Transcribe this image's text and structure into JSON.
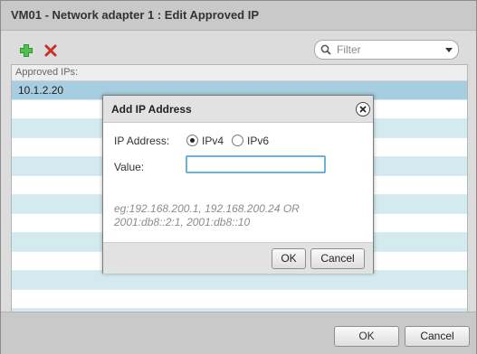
{
  "window": {
    "title": "VM01 - Network adapter 1 : Edit Approved IP",
    "ok_label": "OK",
    "cancel_label": "Cancel"
  },
  "toolbar": {
    "add_icon": "plus-icon",
    "delete_icon": "x-icon",
    "filter_placeholder": "Filter"
  },
  "grid": {
    "header": "Approved IPs:",
    "rows": [
      "10.1.2.20",
      "",
      "",
      "",
      "",
      "",
      "",
      "",
      "",
      "",
      "",
      "",
      ""
    ]
  },
  "dialog": {
    "title": "Add IP Address",
    "ip_address_label": "IP Address:",
    "ipv4_label": "IPv4",
    "ipv6_label": "IPv6",
    "selected": "IPv4",
    "value_label": "Value:",
    "value": "",
    "hint_line1": "eg:192.168.200.1, 192.168.200.24 OR",
    "hint_line2": "2001:db8::2:1, 2001:db8::10",
    "ok_label": "OK",
    "cancel_label": "Cancel"
  },
  "colors": {
    "add_green": "#2e9a2e",
    "delete_red": "#c8322a",
    "selected_row": "#a6cde0",
    "striped_row": "#d3ebef",
    "input_focus": "#6fb0d8"
  }
}
